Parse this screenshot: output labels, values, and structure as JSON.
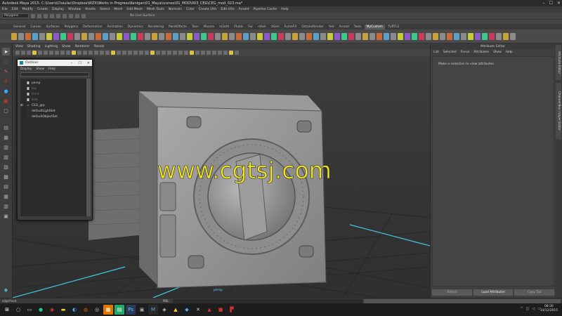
{
  "window": {
    "title": "Autodesk Maya 2015: C:\\Users\\Chaulac\\Dropbox\\WZX\\Works in Progress\\Kenigan\\01_Maya\\scenes\\01_MOD\\003_CEG\\CEG_mod_023.ma*"
  },
  "menubar": [
    "File",
    "Edit",
    "Modify",
    "Create",
    "Display",
    "Window",
    "Assets",
    "Select",
    "Mesh",
    "Edit Mesh",
    "Mesh Tools",
    "Normals",
    "Color",
    "Create UVs",
    "Edit UVs",
    "Arnold",
    "Pipeline Cache",
    "Help"
  ],
  "status": {
    "mode": "Polygons",
    "live_surface": "No Live Surface"
  },
  "shelf_tabs": [
    "General",
    "Curves",
    "Surfaces",
    "Polygons",
    "Deformation",
    "Animation",
    "Dynamics",
    "Rendering",
    "PaintEffects",
    "Toon",
    "Muscle",
    "nCloth",
    "Fluids",
    "Fur",
    "nHair",
    "XGen",
    "FumeFX",
    "OctaneRender",
    "Yeti",
    "Arnold",
    "Tools",
    "MyCustom",
    "TURTLE"
  ],
  "active_shelf_tab": "MyCustom",
  "viewport": {
    "menu": [
      "View",
      "Shading",
      "Lighting",
      "Show",
      "Renderer",
      "Panels"
    ],
    "camera": "persp",
    "watermark": "www.cgtsj.com"
  },
  "outliner": {
    "title": "Outliner",
    "menu": [
      "Display",
      "Show",
      "Help"
    ],
    "items": [
      {
        "label": "persp",
        "icon": "cam",
        "dim": false
      },
      {
        "label": "top",
        "icon": "cam",
        "dim": true
      },
      {
        "label": "front",
        "icon": "cam",
        "dim": true
      },
      {
        "label": "side",
        "icon": "cam",
        "dim": true
      },
      {
        "label": "CEG_grp",
        "icon": "grp",
        "dim": false
      },
      {
        "label": "defaultLightSet",
        "icon": "set",
        "dim": false
      },
      {
        "label": "defaultObjectSet",
        "icon": "set",
        "dim": false
      }
    ]
  },
  "attribute_editor": {
    "title": "Attribute Editor",
    "menu": [
      "List",
      "Selected",
      "Focus",
      "Attributes",
      "Show",
      "Help"
    ],
    "hint": "Make a selection to view attributes",
    "buttons": [
      "Select",
      "Load Attributes",
      "Copy Tab"
    ]
  },
  "side_tabs": [
    "Attribute Editor",
    "Channel Box / Layer Editor"
  ],
  "command_line": {
    "label": "alignPivot",
    "language": "MEL"
  },
  "taskbar": {
    "time": "08:30",
    "date": "14/12/2015"
  },
  "colors": {
    "accent": "#5ac8fa",
    "watermark": "#f5ea1e"
  }
}
